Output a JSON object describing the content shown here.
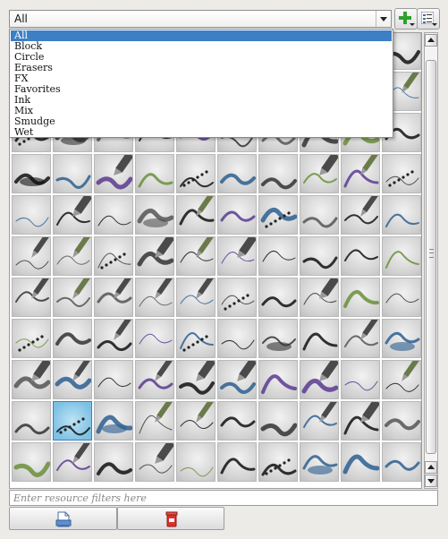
{
  "tag_selector": {
    "selected": "All",
    "options": [
      "All",
      "Block",
      "Circle",
      "Erasers",
      "FX",
      "Favorites",
      "Ink",
      "Mix",
      "Smudge",
      "Wet"
    ],
    "highlighted_index": 0
  },
  "toolbar": {
    "add_icon": "green-plus-icon",
    "view_mode_icon": "list-view-icon"
  },
  "presets_grid": {
    "columns": 10,
    "visible_rows": 11,
    "selected_tile": "row-10-col-2"
  },
  "filter": {
    "placeholder": "Enter resource filters here",
    "value": ""
  },
  "buttons": {
    "import_icon": "import-resource-icon",
    "delete_icon": "delete-resource-icon"
  },
  "colors": {
    "selection": "#3d7fc4",
    "accent_green": "#2fa12f",
    "accent_red": "#d9322a"
  }
}
